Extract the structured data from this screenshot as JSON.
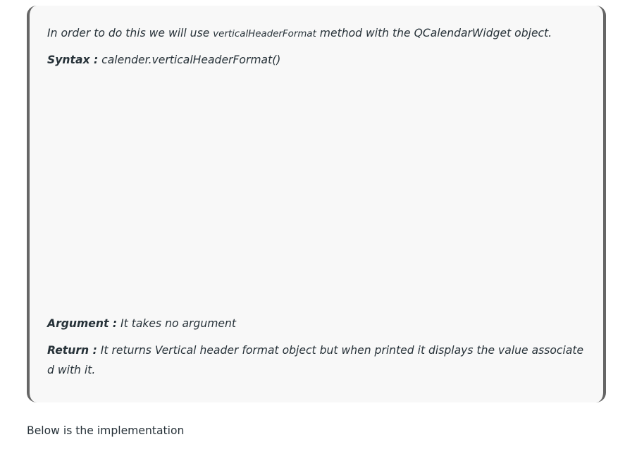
{
  "quote": {
    "intro_before": "In order to do this we will use ",
    "intro_code": "verticalHeaderFormat",
    "intro_after": " method with the QCalendarWidget object.",
    "syntax_label": "Syntax :",
    "syntax_value": " calender.verticalHeaderFormat()",
    "argument_label": "Argument :",
    "argument_value": " It takes no argument",
    "return_label": "Return :",
    "return_value": " It returns Vertical header format object but when printed it displays the value associated with it."
  },
  "after_text": "Below is the implementation"
}
